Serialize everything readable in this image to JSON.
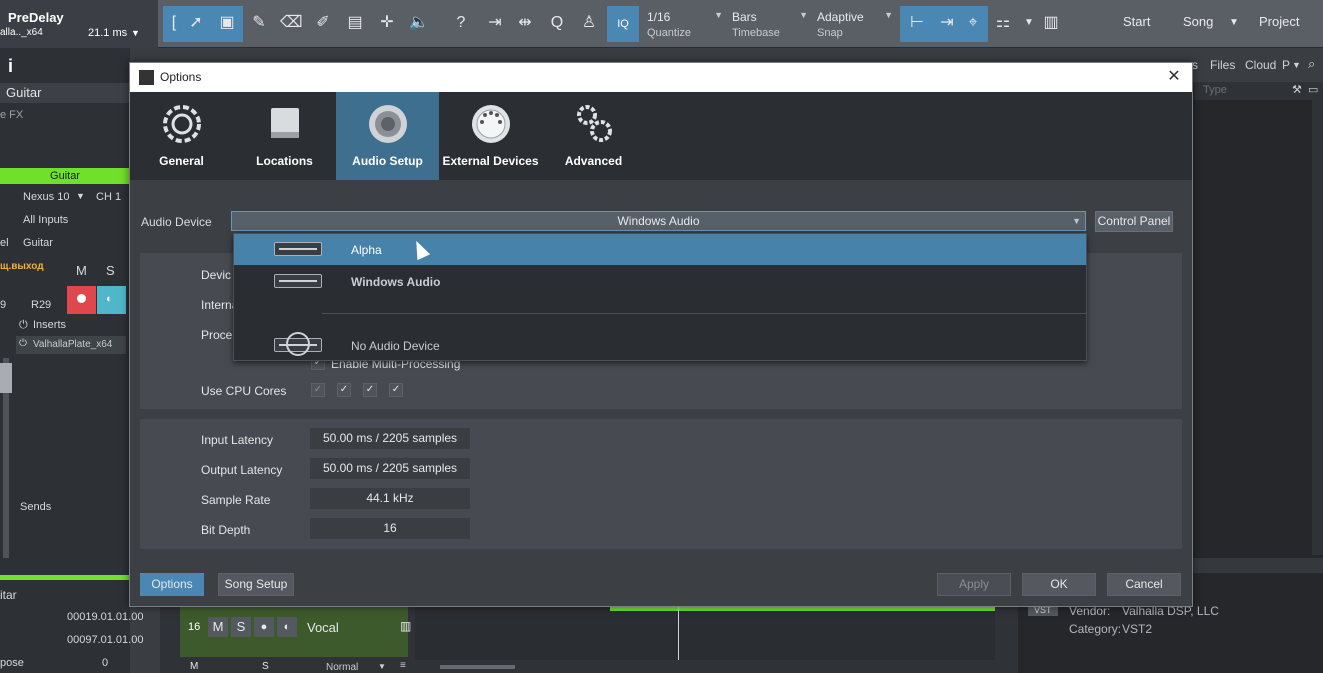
{
  "toolbar": {
    "plugin_name": "PreDelay",
    "plugin_instance": "alla.._x64",
    "latency": "21.1 ms",
    "quantize_value": "1/16",
    "quantize_label": "Quantize",
    "timebase_value": "Bars",
    "timebase_label": "Timebase",
    "snap_value": "Adaptive",
    "snap_label": "Snap",
    "iq_label": "IQ",
    "start_label": "Start",
    "song_label": "Song",
    "project_label": "Project"
  },
  "left_panel": {
    "info_icon": "i",
    "track_name_top": "Guitar",
    "fx_label": "e FX",
    "channel_name": "Guitar",
    "instrument": "Nexus 10",
    "channel": "CH 1",
    "input": "All Inputs",
    "el_label": "el",
    "output_name": "Guitar",
    "output_label": "щ.выход",
    "mute": "M",
    "solo": "S",
    "pan_value": "R29",
    "pan_left": "9",
    "inserts_label": "Inserts",
    "insert_plugin": "ValhallaPlate_x64",
    "sends_label": "Sends",
    "bottom_track": "itar",
    "pos1": "00019.01.01.00",
    "pos2": "00097.01.01.00",
    "transpose_label": "pose",
    "transpose_value": "0"
  },
  "right_panel": {
    "tabs": [
      "s",
      "Files",
      "Cloud",
      "P"
    ],
    "type_label": "Type",
    "vst_badge": "VST",
    "vendor_label": "Vendor:",
    "vendor_value": "Valhalla DSP, LLC",
    "category_label": "Category:",
    "category_value": "VST2"
  },
  "tracks": {
    "track_number": "16",
    "mute": "M",
    "solo": "S",
    "track_name": "Vocal",
    "bottom_m": "M",
    "bottom_s": "S",
    "mode": "Normal"
  },
  "dialog": {
    "title": "Options",
    "tabs": [
      {
        "label": "General",
        "icon": "gear-cycle-icon"
      },
      {
        "label": "Locations",
        "icon": "drive-icon"
      },
      {
        "label": "Audio Setup",
        "icon": "speaker-icon"
      },
      {
        "label": "External Devices",
        "icon": "midi-icon"
      },
      {
        "label": "Advanced",
        "icon": "gears-icon"
      }
    ],
    "audio_device_label": "Audio Device",
    "audio_device_value": "Windows Audio",
    "control_panel_label": "Control Panel",
    "dropdown_options": [
      "Alpha",
      "Windows Audio",
      "No Audio Device"
    ],
    "device_label": "Devic",
    "internal_label": "Interna",
    "process_label": "Proce",
    "multi_processing_label": "Enable Multi-Processing",
    "cpu_cores_label": "Use CPU Cores",
    "input_latency_label": "Input Latency",
    "input_latency_value": "50.00 ms / 2205 samples",
    "output_latency_label": "Output Latency",
    "output_latency_value": "50.00 ms / 2205 samples",
    "sample_rate_label": "Sample Rate",
    "sample_rate_value": "44.1 kHz",
    "bit_depth_label": "Bit Depth",
    "bit_depth_value": "16",
    "options_button": "Options",
    "song_setup_button": "Song Setup",
    "apply_button": "Apply",
    "ok_button": "OK",
    "cancel_button": "Cancel"
  },
  "colors": {
    "accent": "#4a88b3",
    "highlight": "#4682aa",
    "green": "#6fe02b",
    "record": "#e0474c",
    "monitor": "#4fb7c9"
  }
}
